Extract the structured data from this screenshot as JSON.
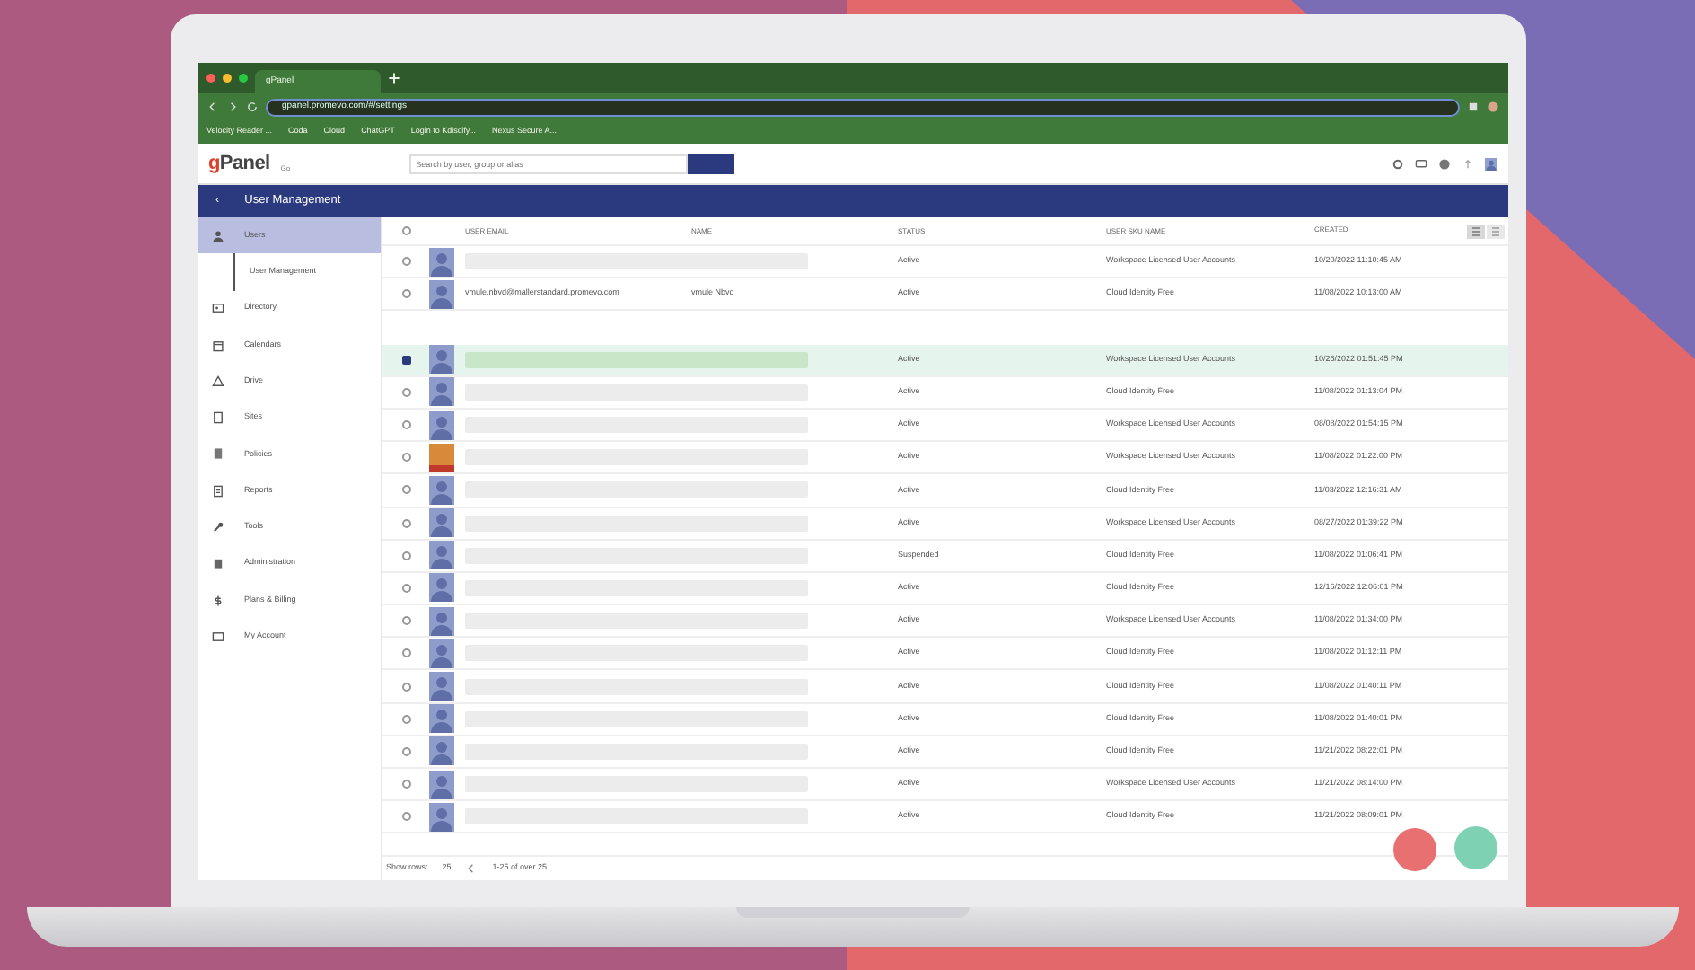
{
  "browser": {
    "tab_title": "gPanel",
    "url": "gpanel.promevo.com/#/settings",
    "bookmarks": [
      "Velocity Reader ...",
      "Coda",
      "Cloud",
      "ChatGPT",
      "Login to Kdiscify...",
      "Nexus Secure A..."
    ]
  },
  "app_header": {
    "logo": "gPanel",
    "logo_suffix": "Go",
    "search": {
      "placeholder": "Search by user, group or alias"
    }
  },
  "title_bar": {
    "back": "‹",
    "title": "User Management"
  },
  "sidebar": {
    "items": [
      {
        "label": "Users",
        "selected": true,
        "children": [
          {
            "label": "User Management",
            "selected": true
          }
        ]
      },
      {
        "label": "Directory",
        "selected": false
      },
      {
        "label": "Calendars",
        "selected": false
      },
      {
        "label": "Drive",
        "selected": false
      },
      {
        "label": "Sites",
        "selected": false
      },
      {
        "label": "Policies",
        "selected": false
      },
      {
        "label": "Reports",
        "selected": false
      },
      {
        "label": "Tools",
        "selected": false
      },
      {
        "label": "Administration",
        "selected": false
      },
      {
        "label": "Plans & Billing",
        "selected": false
      },
      {
        "label": "My Account",
        "selected": false
      }
    ]
  },
  "table": {
    "select_all": {
      "checked": false
    },
    "columns": [
      "USER EMAIL",
      "NAME",
      "STATUS",
      "USER SKU NAME",
      "CREATED"
    ],
    "rows": [
      {
        "kind": "user",
        "selected": false,
        "photo": false,
        "redacted": true,
        "status": "Active",
        "sku": "Workspace Licensed User Accounts",
        "created": "10/20/2022 11:10:45 AM"
      },
      {
        "kind": "user",
        "selected": false,
        "photo": false,
        "redacted": false,
        "email": "vmule.nbvd@mallerstandard.promevo.com",
        "name": "vmule Nbvd",
        "status": "Active",
        "sku": "Cloud Identity Free",
        "created": "11/08/2022 10:13:00 AM"
      },
      {
        "kind": "blank"
      },
      {
        "kind": "user",
        "selected": true,
        "photo": false,
        "redacted": true,
        "status": "Active",
        "sku": "Workspace Licensed User Accounts",
        "created": "10/26/2022 01:51:45 PM"
      },
      {
        "kind": "user",
        "selected": false,
        "photo": false,
        "redacted": true,
        "status": "Active",
        "sku": "Cloud Identity Free",
        "created": "11/08/2022 01:13:04 PM"
      },
      {
        "kind": "user",
        "selected": false,
        "photo": false,
        "redacted": true,
        "status": "Active",
        "sku": "Workspace Licensed User Accounts",
        "created": "08/08/2022 01:54:15 PM"
      },
      {
        "kind": "user",
        "selected": false,
        "photo": true,
        "redacted": true,
        "status": "Active",
        "sku": "Workspace Licensed User Accounts",
        "created": "11/08/2022 01:22:00 PM"
      },
      {
        "kind": "user",
        "selected": false,
        "photo": false,
        "redacted": true,
        "status": "Active",
        "sku": "Cloud Identity Free",
        "created": "11/03/2022 12:16:31 AM"
      },
      {
        "kind": "user",
        "selected": false,
        "photo": false,
        "redacted": true,
        "status": "Active",
        "sku": "Workspace Licensed User Accounts",
        "created": "08/27/2022 01:39:22 PM"
      },
      {
        "kind": "user",
        "selected": false,
        "photo": false,
        "redacted": true,
        "status": "Suspended",
        "sku": "Cloud Identity Free",
        "created": "11/08/2022 01:06:41 PM"
      },
      {
        "kind": "user",
        "selected": false,
        "photo": false,
        "redacted": true,
        "status": "Active",
        "sku": "Cloud Identity Free",
        "created": "12/16/2022 12:06:01 PM"
      },
      {
        "kind": "user",
        "selected": false,
        "photo": false,
        "redacted": true,
        "status": "Active",
        "sku": "Workspace Licensed User Accounts",
        "created": "11/08/2022 01:34:00 PM"
      },
      {
        "kind": "user",
        "selected": false,
        "photo": false,
        "redacted": true,
        "status": "Active",
        "sku": "Cloud Identity Free",
        "created": "11/08/2022 01:12:11 PM"
      },
      {
        "kind": "user",
        "selected": false,
        "photo": false,
        "redacted": true,
        "status": "Active",
        "sku": "Cloud Identity Free",
        "created": "11/08/2022 01:40:11 PM"
      },
      {
        "kind": "user",
        "selected": false,
        "photo": false,
        "redacted": true,
        "status": "Active",
        "sku": "Cloud Identity Free",
        "created": "11/08/2022 01:40:01 PM"
      },
      {
        "kind": "user",
        "selected": false,
        "photo": false,
        "redacted": true,
        "status": "Active",
        "sku": "Cloud Identity Free",
        "created": "11/21/2022 08:22:01 PM"
      },
      {
        "kind": "user",
        "selected": false,
        "photo": false,
        "redacted": true,
        "status": "Active",
        "sku": "Workspace Licensed User Accounts",
        "created": "11/21/2022 08:14:00 PM"
      },
      {
        "kind": "user",
        "selected": false,
        "photo": false,
        "redacted": true,
        "status": "Active",
        "sku": "Cloud Identity Free",
        "created": "11/21/2022 08:09:01 PM"
      }
    ]
  },
  "footer": {
    "rows_label": "Show rows:",
    "rows_value": "25",
    "range": "1-25 of over 25"
  }
}
